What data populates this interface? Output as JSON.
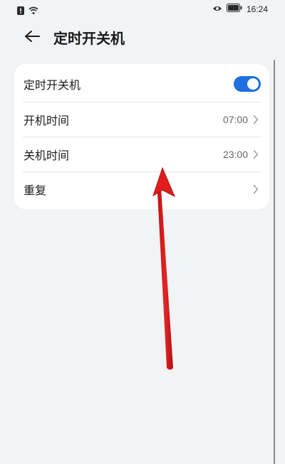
{
  "status_bar": {
    "time": "16:24",
    "icons": [
      "alert-icon",
      "wifi-icon",
      "eye-icon",
      "battery-icon"
    ]
  },
  "header": {
    "back_icon": "arrow-left-icon",
    "title": "定时开关机"
  },
  "settings": {
    "toggle_row": {
      "label": "定时开关机",
      "enabled": true
    },
    "power_on": {
      "label": "开机时间",
      "value": "07:00"
    },
    "power_off": {
      "label": "关机时间",
      "value": "23:00"
    },
    "repeat": {
      "label": "重复",
      "value": ""
    }
  },
  "colors": {
    "accent": "#1f6fe0",
    "background": "#f1f3f5",
    "card": "#ffffff",
    "annotation": "#d81e1e"
  }
}
